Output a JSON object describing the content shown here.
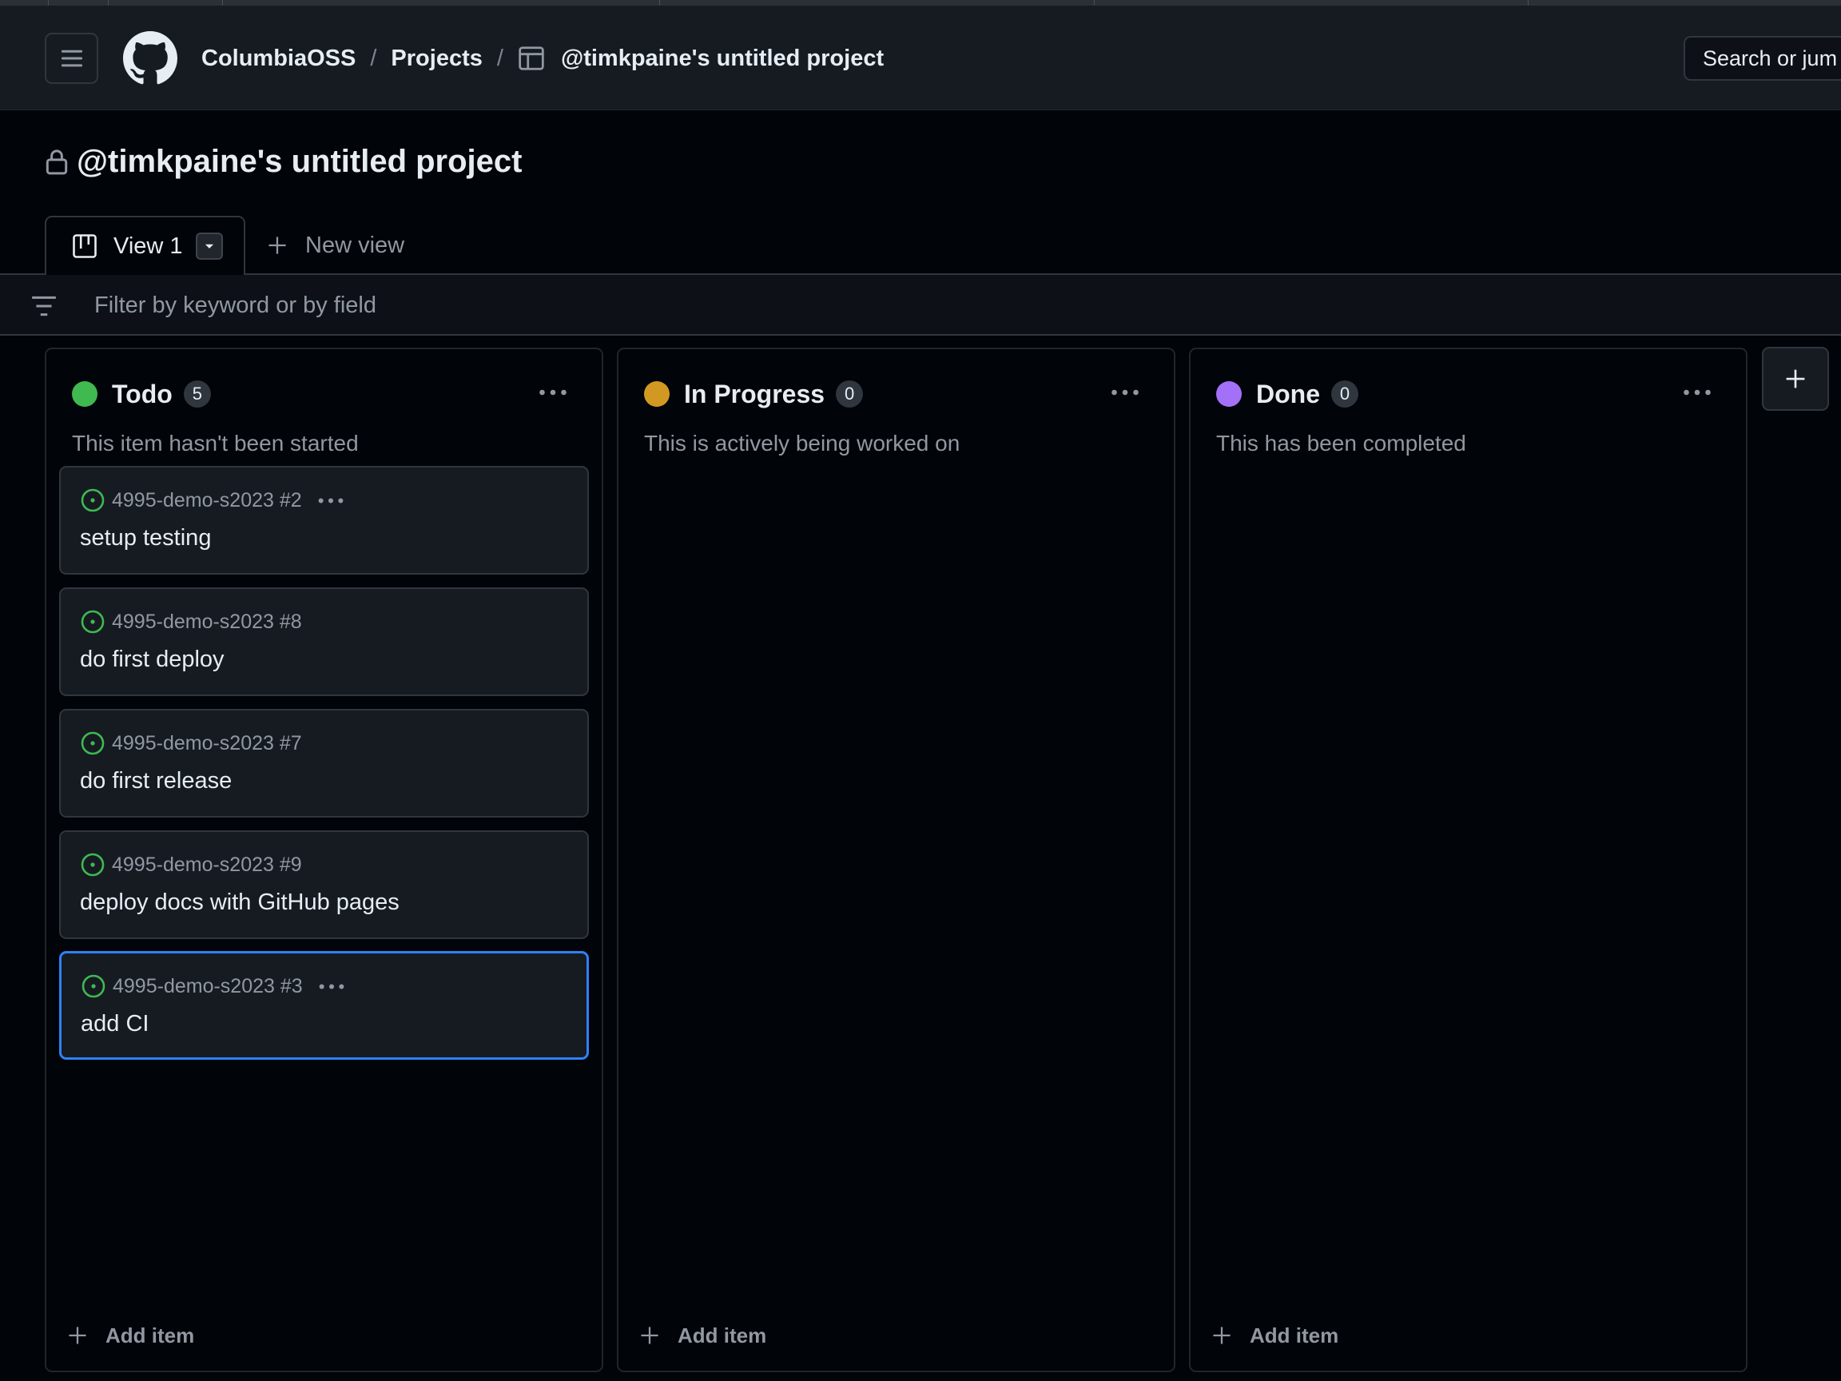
{
  "header": {
    "breadcrumb": {
      "org": "ColumbiaOSS",
      "projects": "Projects",
      "project": "@timkpaine's untitled project",
      "separator": "/"
    },
    "search_text": "Search or jum"
  },
  "project": {
    "title": "@timkpaine's untitled project"
  },
  "views": {
    "active_tab": "View 1",
    "new_view_label": "New view"
  },
  "filter": {
    "placeholder": "Filter by keyword or by field"
  },
  "columns": [
    {
      "name": "Todo",
      "count": "5",
      "description": "This item hasn't been started",
      "color": "#3fb950",
      "add_item_label": "Add item",
      "cards": [
        {
          "repo": "4995-demo-s2023 #2",
          "title": "setup testing"
        },
        {
          "repo": "4995-demo-s2023 #8",
          "title": "do first deploy"
        },
        {
          "repo": "4995-demo-s2023 #7",
          "title": "do first release"
        },
        {
          "repo": "4995-demo-s2023 #9",
          "title": "deploy docs with GitHub pages"
        },
        {
          "repo": "4995-demo-s2023 #3",
          "title": "add CI"
        }
      ]
    },
    {
      "name": "In Progress",
      "count": "0",
      "description": "This is actively being worked on",
      "color": "#d29922",
      "add_item_label": "Add item",
      "cards": []
    },
    {
      "name": "Done",
      "count": "0",
      "description": "This has been completed",
      "color": "#a371f7",
      "add_item_label": "Add item",
      "cards": []
    }
  ],
  "colors": {
    "accent_selected": "#2f81f7",
    "issue_open": "#3fb950"
  },
  "icons": {
    "menu": "hamburger-icon",
    "logo": "github-logo-icon",
    "table": "table-icon",
    "lock": "lock-icon",
    "board": "board-icon",
    "filter": "filter-icon",
    "issue": "issue-open-icon",
    "more": "kebab-horizontal-icon",
    "plus": "plus-icon"
  }
}
